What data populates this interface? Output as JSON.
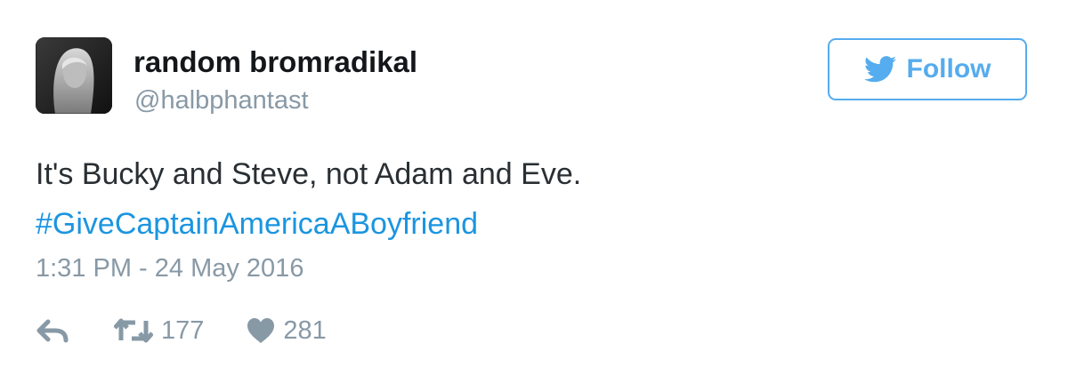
{
  "tweet": {
    "author": {
      "name": "random bromradikal",
      "handle": "@halbphantast"
    },
    "follow_label": "Follow",
    "text_line": "It's Bucky and Steve, not Adam and Eve.",
    "hashtag": "#GiveCaptainAmericaABoyfriend",
    "timestamp": "1:31 PM - 24 May 2016",
    "stats": {
      "retweets": "177",
      "likes": "281"
    }
  },
  "colors": {
    "accent": "#55acee",
    "hashtag": "#1b95e0",
    "muted": "#8899a6",
    "text": "#292f33"
  },
  "icons": {
    "follow": "twitter-bird-icon",
    "reply": "reply-icon",
    "retweet": "retweet-icon",
    "like": "heart-icon"
  }
}
